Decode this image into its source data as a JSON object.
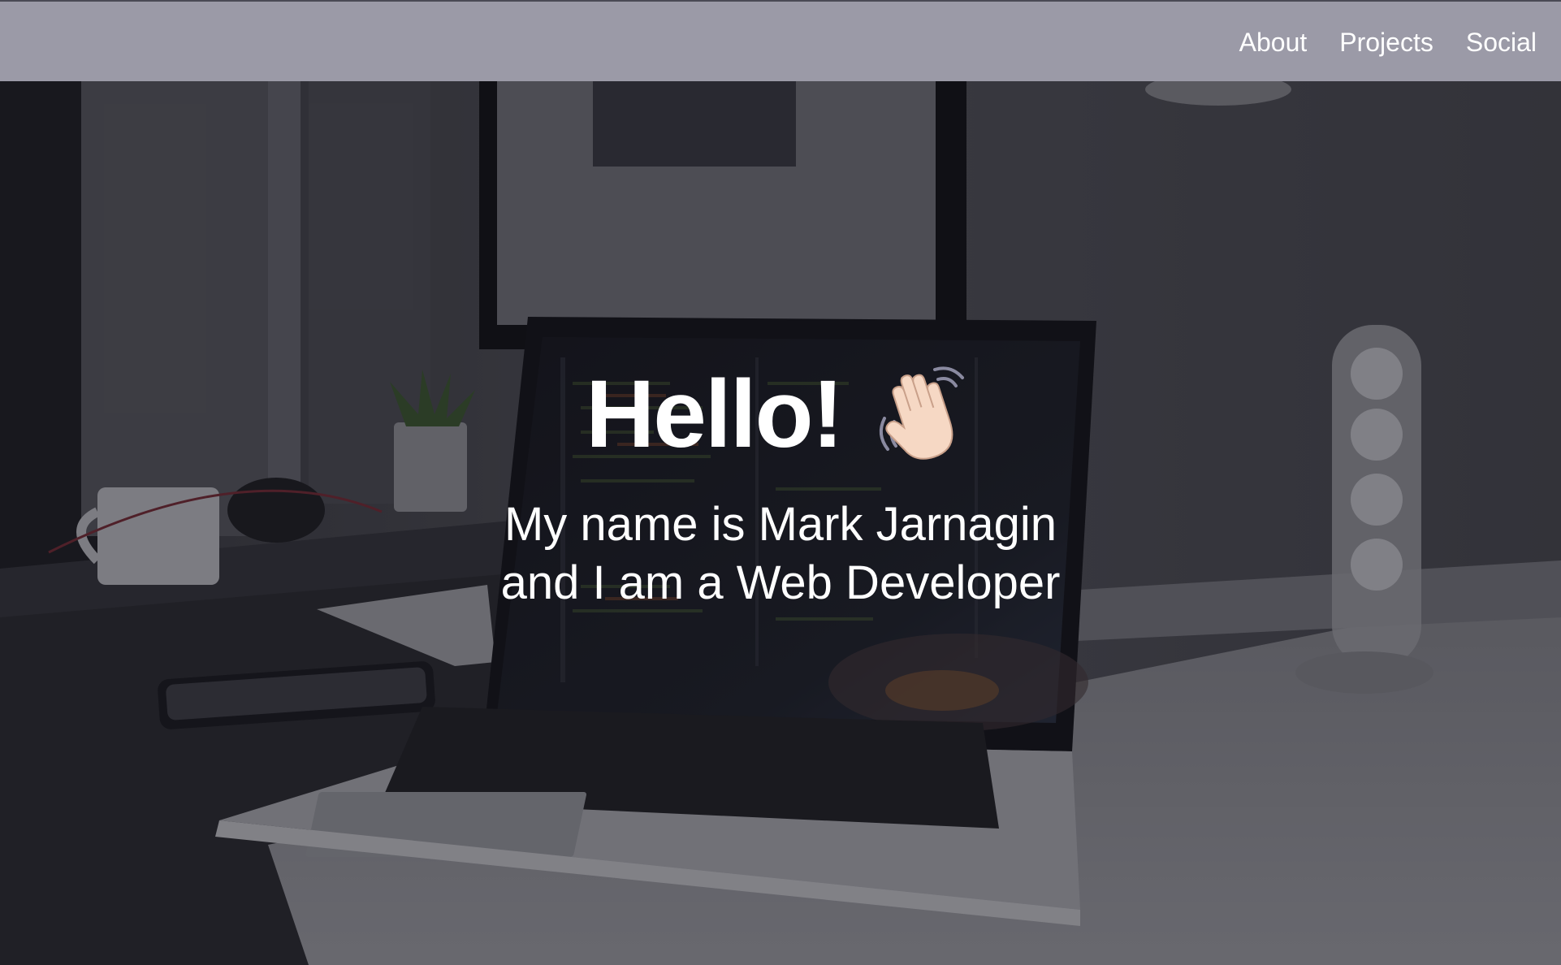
{
  "nav": {
    "links": [
      {
        "label": "About"
      },
      {
        "label": "Projects"
      },
      {
        "label": "Social"
      }
    ]
  },
  "hero": {
    "title": "Hello!",
    "wave_icon": "waving-hand-icon",
    "subtitle_line1": "My name is Mark Jarnagin",
    "subtitle_line2": "and I am a Web Developer"
  },
  "colors": {
    "navbar_bg": "#9b9aa7",
    "text": "#ffffff",
    "overlay": "rgba(20,20,28,0.42)"
  }
}
